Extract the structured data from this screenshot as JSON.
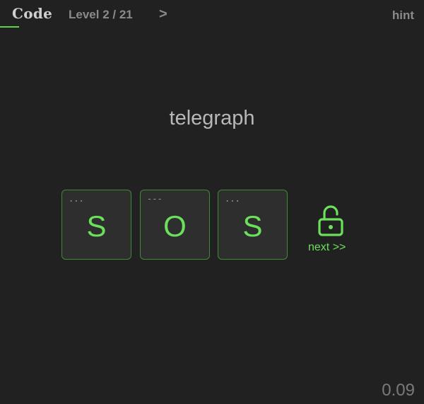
{
  "header": {
    "brand": "Code",
    "level_text": "Level 2 / 21",
    "next_level_symbol": ">",
    "hint_label": "hint"
  },
  "puzzle": {
    "word": "telegraph",
    "tiles": [
      {
        "code": "...",
        "letter": "S"
      },
      {
        "code": "---",
        "letter": "O"
      },
      {
        "code": "...",
        "letter": "S"
      }
    ],
    "unlock_icon": "unlocked-padlock-icon",
    "next_label": "next  >>"
  },
  "timer": "0.09",
  "colors": {
    "background": "#212121",
    "accent": "#6be05a",
    "tile_border": "#3f8a34",
    "muted_text": "#8a8a8a"
  }
}
